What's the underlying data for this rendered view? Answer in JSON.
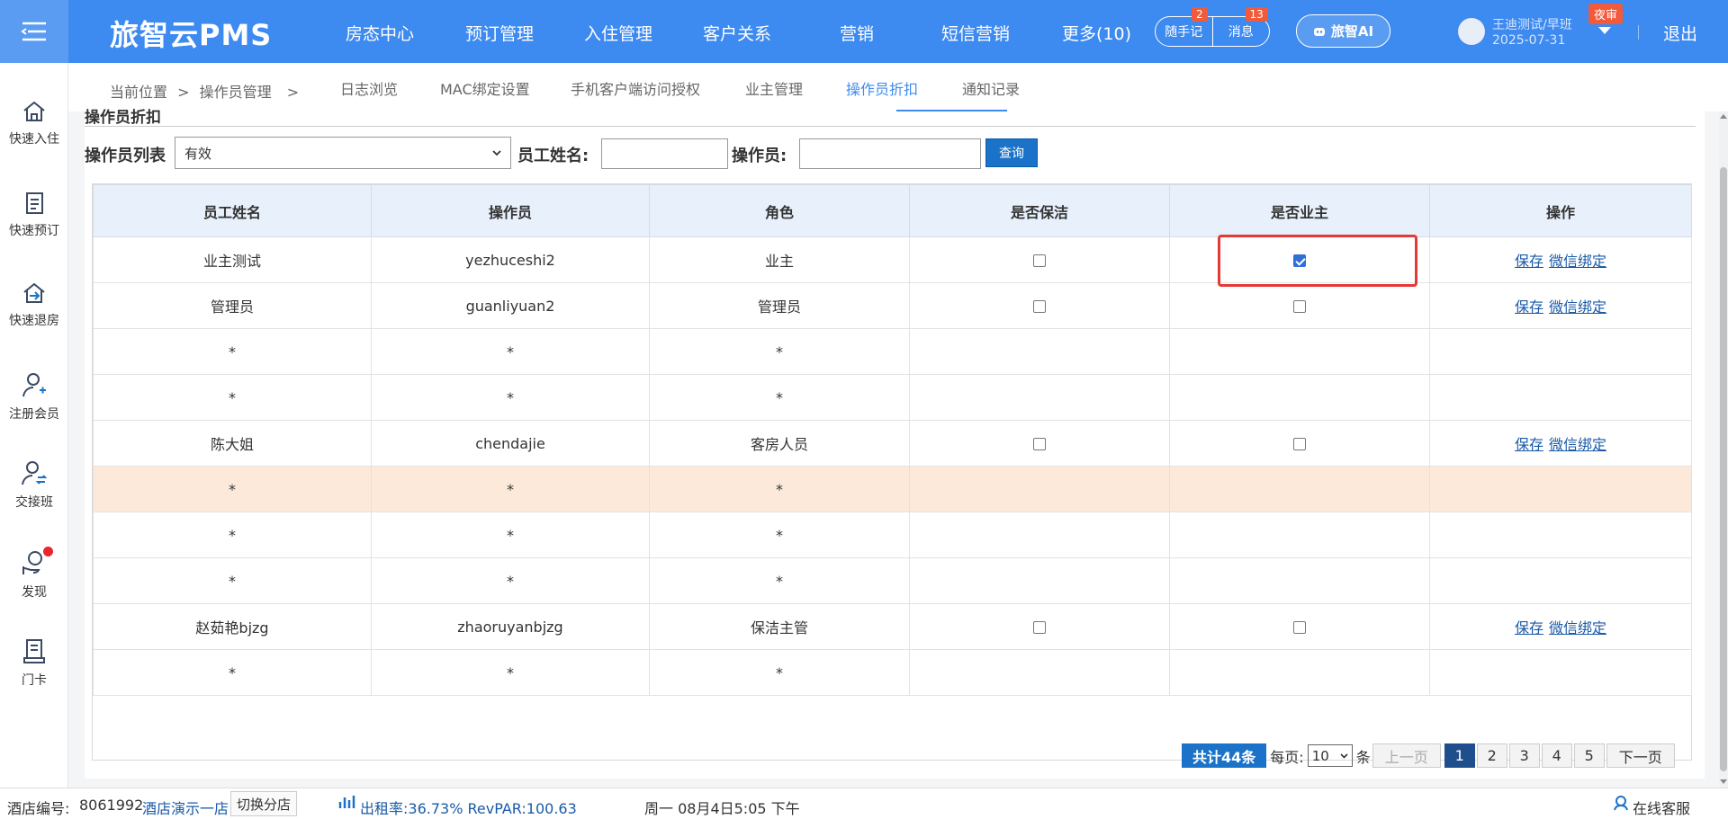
{
  "app": {
    "brand": "旅智云PMS",
    "nav": [
      "房态中心",
      "预订管理",
      "入住管理",
      "客户关系",
      "营销",
      "短信营销",
      "更多(10)"
    ],
    "notes": {
      "label": "随手记",
      "badge": "2"
    },
    "messages": {
      "label": "消息",
      "badge": "13"
    },
    "ai_label": "旅智AI",
    "user": {
      "name": "王迪测试/早班",
      "date": "2025-07-31",
      "night_badge": "夜审"
    },
    "logout": "退出"
  },
  "sidebar": [
    {
      "label": "快速入住",
      "icon": "home-icon"
    },
    {
      "label": "快速预订",
      "icon": "booking-list-icon"
    },
    {
      "label": "快速退房",
      "icon": "checkout-icon"
    },
    {
      "label": "注册会员",
      "icon": "add-member-icon"
    },
    {
      "label": "交接班",
      "icon": "shift-handover-icon"
    },
    {
      "label": "发现",
      "icon": "discover-icon"
    },
    {
      "label": "门卡",
      "icon": "door-card-icon"
    }
  ],
  "breadcrumb": {
    "current": "当前位置",
    "sep": ">",
    "parent": "操作员管理",
    "sep2": ">"
  },
  "tabs": [
    "日志浏览",
    "MAC绑定设置",
    "手机客户端访问授权",
    "业主管理",
    "操作员折扣",
    "通知记录"
  ],
  "active_tab": "操作员折扣",
  "section_title": "操作员折扣",
  "filters": {
    "list_label": "操作员列表",
    "list_value": "有效",
    "staff_label": "员工姓名:",
    "staff_value": "",
    "operator_label": "操作员:",
    "operator_value": "",
    "query_label": "查询"
  },
  "table": {
    "headers": [
      "员工姓名",
      "操作员",
      "角色",
      "是否保洁",
      "是否业主",
      "操作"
    ],
    "save_label": "保存",
    "wechat_label": "微信绑定",
    "rows": [
      {
        "name": "业主测试",
        "operator": "yezhuceshi2",
        "role": "业主",
        "cleaner": false,
        "owner": true,
        "actions": true
      },
      {
        "name": "管理员",
        "operator": "guanliyuan2",
        "role": "管理员",
        "cleaner": false,
        "owner": false,
        "actions": true
      },
      {
        "name": "*",
        "operator": "*",
        "role": "*",
        "actions": false
      },
      {
        "name": "*",
        "operator": "*",
        "role": "*",
        "actions": false
      },
      {
        "name": "陈大姐",
        "operator": "chendajie",
        "role": "客房人员",
        "cleaner": false,
        "owner": false,
        "actions": true
      },
      {
        "name": "*",
        "operator": "*",
        "role": "*",
        "actions": false,
        "highlight": true
      },
      {
        "name": "*",
        "operator": "*",
        "role": "*",
        "actions": false
      },
      {
        "name": "*",
        "operator": "*",
        "role": "*",
        "actions": false
      },
      {
        "name": "赵茹艳bjzg",
        "operator": "zhaoruyanbjzg",
        "role": "保洁主管",
        "cleaner": false,
        "owner": false,
        "actions": true
      },
      {
        "name": "*",
        "operator": "*",
        "role": "*",
        "actions": false
      }
    ]
  },
  "pager": {
    "total": "共计44条",
    "per_page_label": "每页:",
    "per_page_value": "10",
    "per_page_unit": "条",
    "prev": "上一页",
    "pages": [
      "1",
      "2",
      "3",
      "4",
      "5"
    ],
    "current_page": "1",
    "next": "下一页"
  },
  "status": {
    "hotel_no_label": "酒店编号:",
    "hotel_no": "8061992",
    "hotel_name": "酒店演示一店",
    "switch_label": "切换分店",
    "occupancy": "出租率:36.73% RevPAR:100.63",
    "datetime": "周一 08月4日5:05 下午",
    "service": "在线客服"
  },
  "colors": {
    "primary": "#3d8af0",
    "highlight_row": "#fde9d9",
    "query_btn": "#1a73c8",
    "badge": "#f15a3a"
  }
}
